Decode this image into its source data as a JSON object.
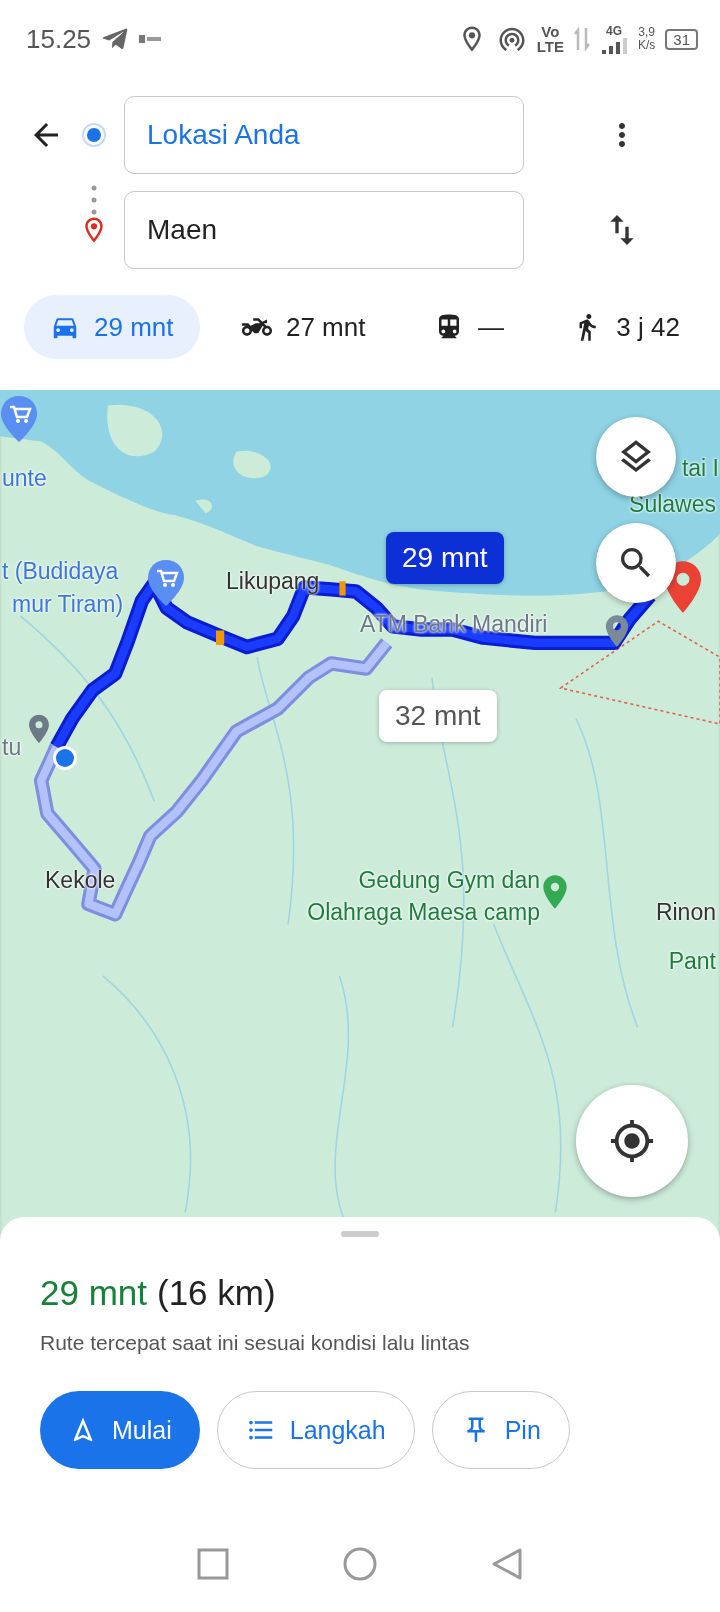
{
  "status_bar": {
    "time": "15.25",
    "volte": [
      "Vo",
      "LTE"
    ],
    "network_type": "4G",
    "speed": [
      "3,9",
      "K/s"
    ],
    "battery": "31"
  },
  "directions": {
    "origin": "Lokasi Anda",
    "destination": "Maen"
  },
  "modes": [
    {
      "kind": "car",
      "label": "29 mnt",
      "selected": true
    },
    {
      "kind": "motorcycle",
      "label": "27 mnt",
      "selected": false
    },
    {
      "kind": "transit",
      "label": "—",
      "selected": false
    },
    {
      "kind": "walk",
      "label": "3 j 42",
      "selected": false
    }
  ],
  "map": {
    "labels": [
      {
        "kind": "shop",
        "text": "unte"
      },
      {
        "kind": "park",
        "text": "tai I"
      },
      {
        "kind": "park",
        "text": "Sulawes"
      },
      {
        "kind": "shop",
        "text": "t (Budidaya"
      },
      {
        "kind": "shop",
        "text": "mur Tiram)"
      },
      {
        "kind": "town",
        "text": "Likupang"
      },
      {
        "kind": "landmark",
        "text": "ATM Bank Mandiri"
      },
      {
        "kind": "landmark",
        "text": "tu"
      },
      {
        "kind": "town",
        "text": "Kekole"
      },
      {
        "kind": "park",
        "text": "Gedung Gym dan Olahraga Maesa camp"
      },
      {
        "kind": "town",
        "text": "Rinon"
      },
      {
        "kind": "park",
        "text": "Pant"
      }
    ],
    "route_callouts": [
      {
        "text": "29 mnt",
        "selected": true
      },
      {
        "text": "32 mnt",
        "selected": false
      }
    ]
  },
  "summary": {
    "duration": "29 mnt",
    "distance": "(16 km)",
    "description": "Rute tercepat saat ini sesuai kondisi lalu lintas"
  },
  "actions": [
    {
      "kind": "start",
      "label": "Mulai"
    },
    {
      "kind": "steps",
      "label": "Langkah"
    },
    {
      "kind": "pin",
      "label": "Pin"
    }
  ]
}
